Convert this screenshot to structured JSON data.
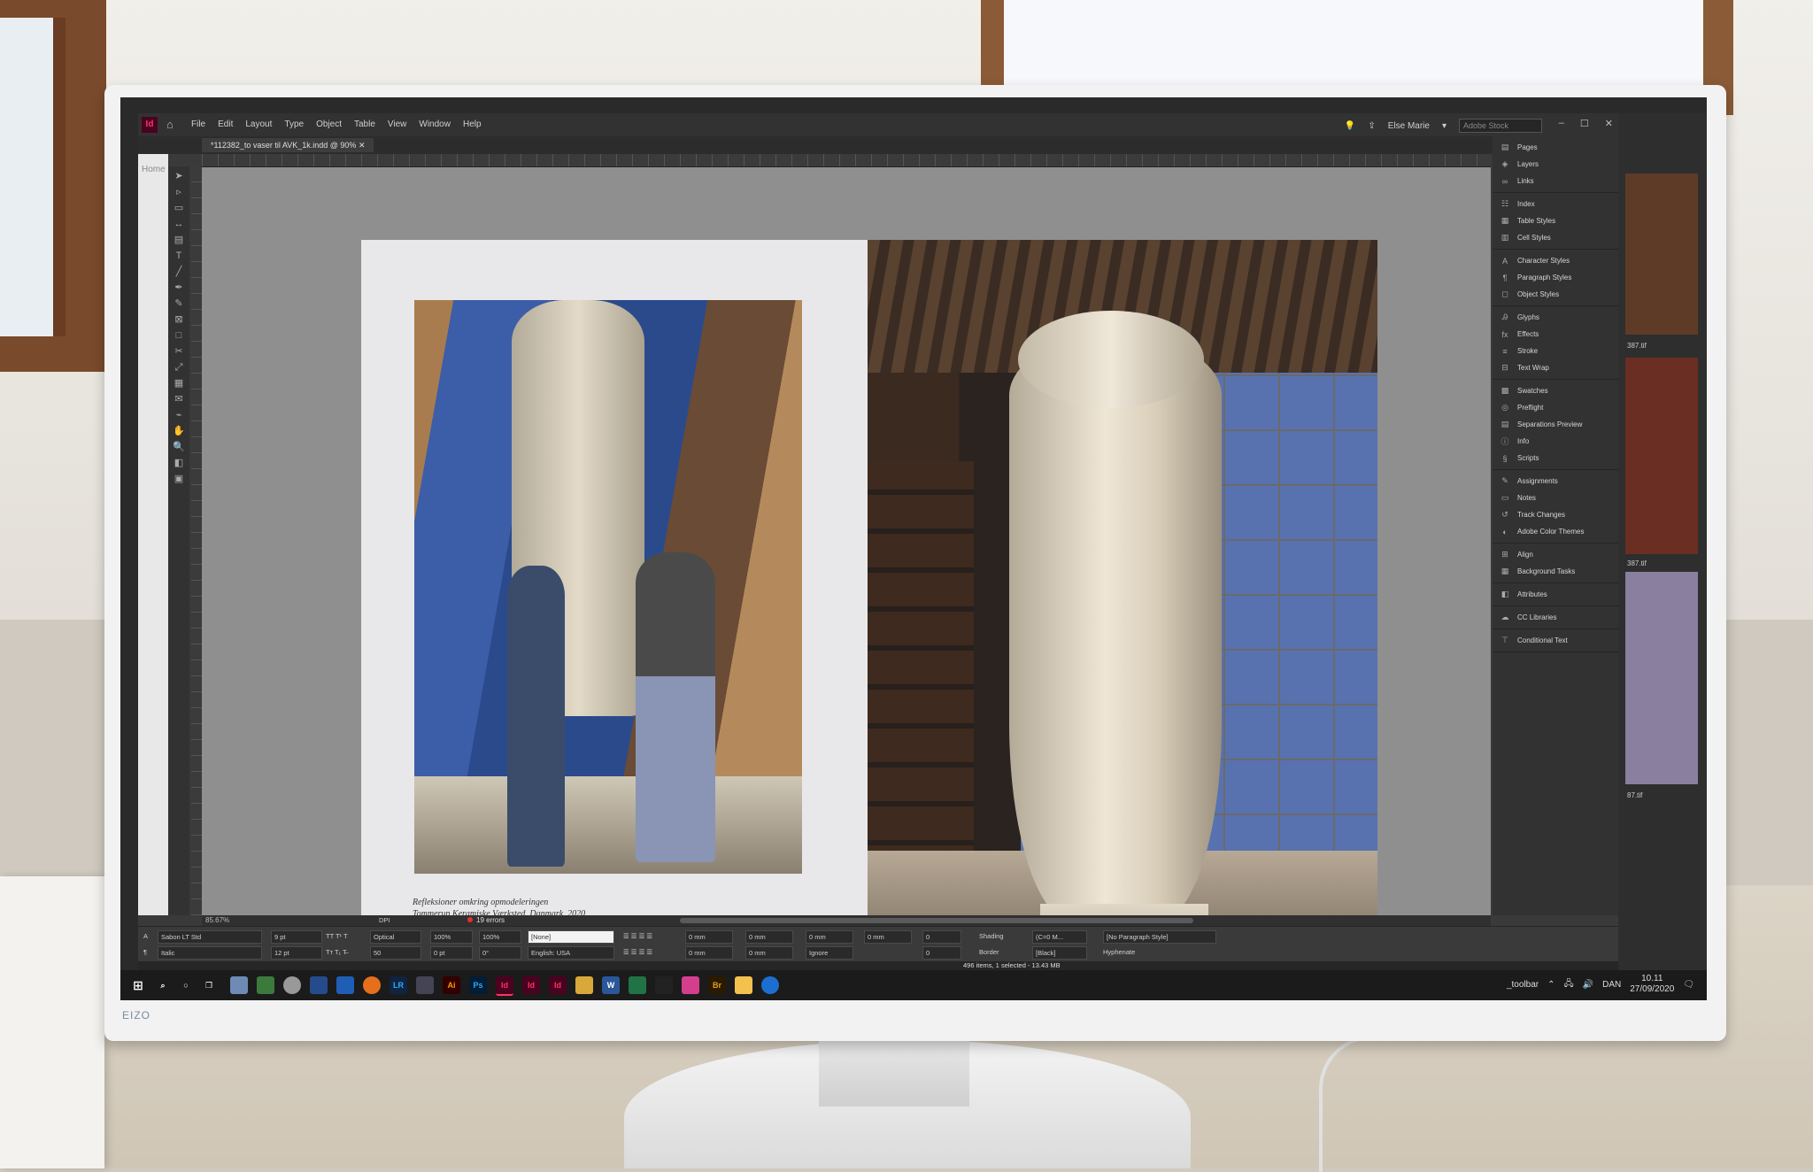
{
  "app": {
    "menus": [
      "File",
      "Edit",
      "Layout",
      "Type",
      "Object",
      "Table",
      "View",
      "Window",
      "Help"
    ],
    "user": "Else Marie",
    "search_placeholder": "Adobe Stock",
    "doc_tab": "*112382_to vaser til AVK_1k.indd @ 90%",
    "ghost_label": "Home"
  },
  "panels": [
    [
      "Pages",
      "Layers",
      "Links"
    ],
    [
      "Index",
      "Table Styles",
      "Cell Styles"
    ],
    [
      "Character Styles",
      "Paragraph Styles",
      "Object Styles"
    ],
    [
      "Glyphs",
      "Effects",
      "Stroke",
      "Text Wrap"
    ],
    [
      "Swatches",
      "Preflight",
      "Separations Preview",
      "Info",
      "Scripts"
    ],
    [
      "Assignments",
      "Notes",
      "Track Changes",
      "Adobe Color Themes"
    ],
    [
      "Align",
      "Background Tasks"
    ],
    [
      "Attributes"
    ],
    [
      "CC Libraries"
    ],
    [
      "Conditional Text"
    ]
  ],
  "caption": {
    "line1": "Refleksioner omkring opmodeleringen",
    "line2": "Tommerup Keramiske Værksted, Danmark, 2020"
  },
  "scrollbar": {
    "zoom": "85.67%",
    "errors": "19 errors",
    "profile": "DPI"
  },
  "control": {
    "font": "Sabon LT Std",
    "style": "Italic",
    "size": "9 pt",
    "leading": "12 pt",
    "kerning": "Optical",
    "tracking": "50",
    "vscale": "100%",
    "hscale": "100%",
    "baseline": "0 pt",
    "skew": "0°",
    "char_style": "[None]",
    "language": "English: USA",
    "indent1": "0 mm",
    "indent2": "0 mm",
    "indent3": "0 mm",
    "indent4": "0 mm",
    "space1": "0 mm",
    "space2": "0 mm",
    "dropcap1": "0",
    "dropcap2": "0",
    "grid_align": "Ignore",
    "shading": "Shading",
    "border": "Border",
    "shade_color": "(C=0 M...",
    "border_color": "[Black]",
    "para_style": "[No Paragraph Style]",
    "hyphenate": "Hyphenate"
  },
  "status": {
    "info": "496 items, 1 selected - 13.43 MB"
  },
  "bg_window": {
    "file1": "387.tif",
    "file2": "387.tif",
    "file3": "87.tif"
  },
  "taskbar": {
    "apps": [
      "LR",
      "Ai",
      "Ps",
      "Id",
      "Id",
      "Id",
      "Br"
    ],
    "toolbar_label": "_toolbar",
    "lang": "DAN",
    "time": "10.11",
    "date": "27/09/2020"
  },
  "monitor": {
    "brand": "EIZO"
  },
  "colors": {
    "indesign": "#ff3366",
    "error": "#e2312a"
  }
}
